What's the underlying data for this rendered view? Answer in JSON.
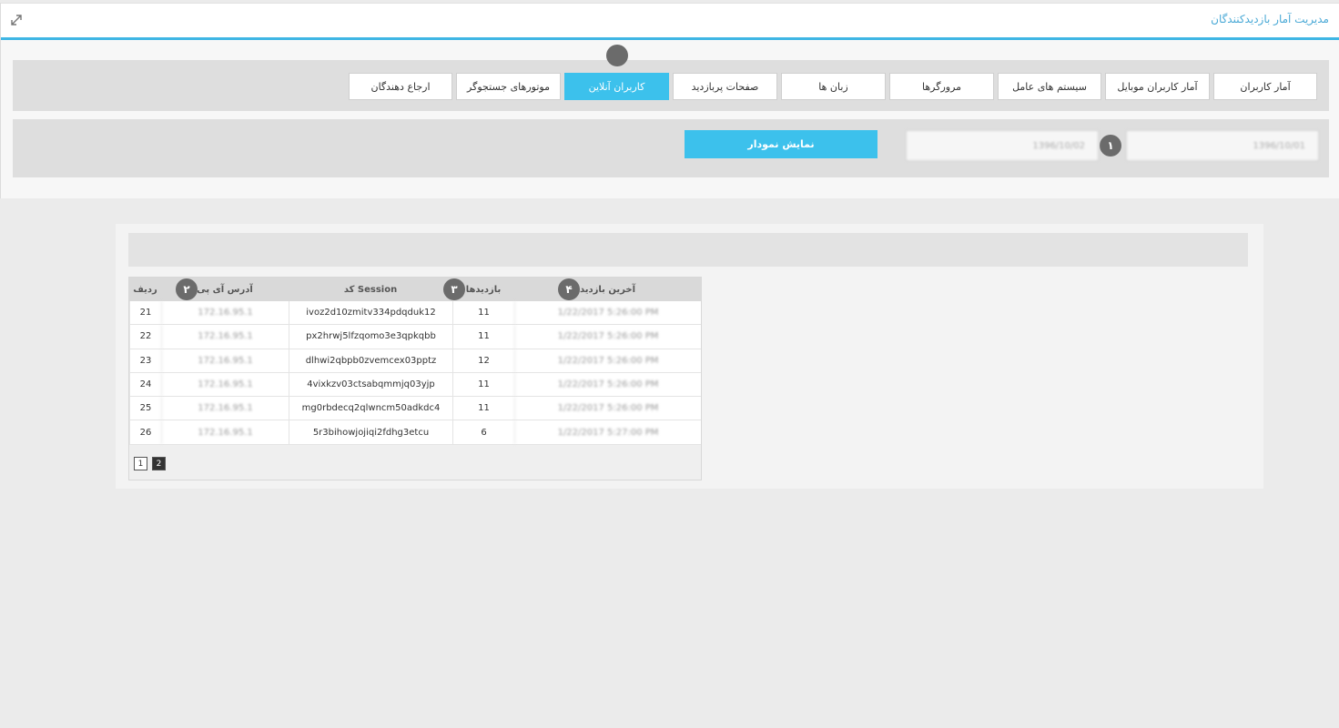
{
  "header": {
    "title": "مدیریت آمار بازدیدکنندگان",
    "expand_icon": "expand-arrows-icon"
  },
  "tabs": [
    {
      "label": "آمار کاربران",
      "active": false
    },
    {
      "label": "آمار کاربران موبایل",
      "active": false
    },
    {
      "label": "سیستم های عامل",
      "active": false
    },
    {
      "label": "مرورگرها",
      "active": false
    },
    {
      "label": "زبان ها",
      "active": false
    },
    {
      "label": "صفحات پربازدید",
      "active": false
    },
    {
      "label": "کاربران آنلاین",
      "active": true
    },
    {
      "label": "موتورهای جستجوگر",
      "active": false
    },
    {
      "label": "ارجاع دهندگان",
      "active": false
    }
  ],
  "filter": {
    "from_date": "1396/10/01",
    "to_date": "1396/10/02",
    "show_chart_label": "نمایش نمودار"
  },
  "markers": [
    "١",
    "٢",
    "٣",
    "۴"
  ],
  "table": {
    "columns": {
      "row": "ردیف",
      "ip": "آدرس آی پی",
      "session": "Session کد",
      "visits": "بازدیدها",
      "last_visit": "آخرین بازدید"
    },
    "rows": [
      {
        "row": "21",
        "ip": "172.16.95.1",
        "session": "ivoz2d10zmitv334pdqduk12",
        "visits": "11",
        "last_visit": "1/22/2017 5:26:00 PM"
      },
      {
        "row": "22",
        "ip": "172.16.95.1",
        "session": "px2hrwj5lfzqomo3e3qpkqbb",
        "visits": "11",
        "last_visit": "1/22/2017 5:26:00 PM"
      },
      {
        "row": "23",
        "ip": "172.16.95.1",
        "session": "dlhwi2qbpb0zvemcex03pptz",
        "visits": "12",
        "last_visit": "1/22/2017 5:26:00 PM"
      },
      {
        "row": "24",
        "ip": "172.16.95.1",
        "session": "4vixkzv03ctsabqmmjq03yjp",
        "visits": "11",
        "last_visit": "1/22/2017 5:26:00 PM"
      },
      {
        "row": "25",
        "ip": "172.16.95.1",
        "session": "mg0rbdecq2qlwncm50adkdc4",
        "visits": "11",
        "last_visit": "1/22/2017 5:26:00 PM"
      },
      {
        "row": "26",
        "ip": "172.16.95.1",
        "session": "5r3bihowjojiqi2fdhg3etcu",
        "visits": "6",
        "last_visit": "1/22/2017 5:27:00 PM"
      }
    ]
  },
  "pagination": {
    "pages": [
      "1",
      "2"
    ],
    "current": "2"
  }
}
